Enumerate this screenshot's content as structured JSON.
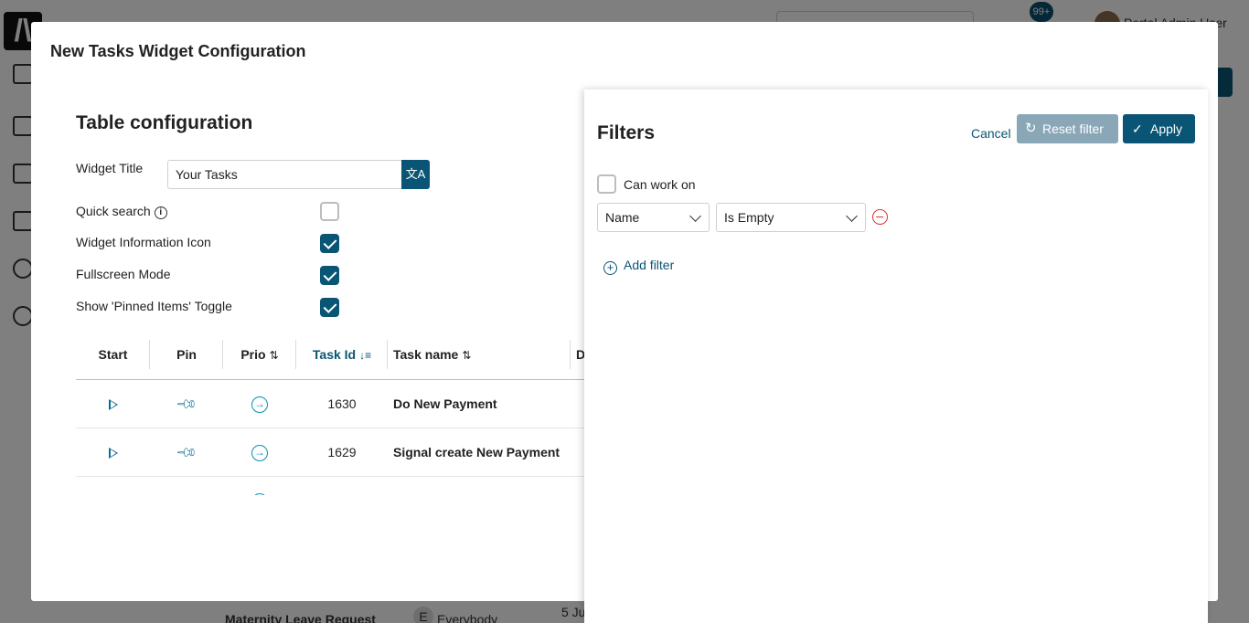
{
  "background": {
    "notifications_badge": "99+",
    "user_name": "Portal Admin User",
    "row": {
      "name": "Maternity Leave Request",
      "assignee_initial": "E",
      "assignee": "Everybody",
      "date": "5 Ju"
    }
  },
  "modal": {
    "title": "New Tasks Widget Configuration",
    "section_title": "Table configuration",
    "widget_title_label": "Widget Title",
    "widget_title_value": "Your Tasks",
    "translate_icon": "translate-icon",
    "options": [
      {
        "label": "Quick search",
        "checked": false,
        "info": true
      },
      {
        "label": "Widget Information Icon",
        "checked": true,
        "info": false
      },
      {
        "label": "Fullscreen Mode",
        "checked": true,
        "info": false
      },
      {
        "label": "Show 'Pinned Items' Toggle",
        "checked": true,
        "info": false
      }
    ],
    "table": {
      "headers": [
        "Start",
        "Pin",
        "Prio",
        "Task Id",
        "Task name",
        "D"
      ],
      "rows": [
        {
          "id": "1630",
          "name": "Do New Payment"
        },
        {
          "id": "1629",
          "name": "Signal create New Payment"
        }
      ]
    }
  },
  "filters": {
    "title": "Filters",
    "cancel_label": "Cancel",
    "reset_label": "Reset filter",
    "apply_label": "Apply",
    "can_work_on_label": "Can work on",
    "field_select": "Name",
    "operator_select": "Is Empty",
    "add_filter_label": "Add filter"
  },
  "colors": {
    "primary": "#0a5575",
    "reset_button": "#8aa7b8",
    "danger": "#dd3333"
  }
}
